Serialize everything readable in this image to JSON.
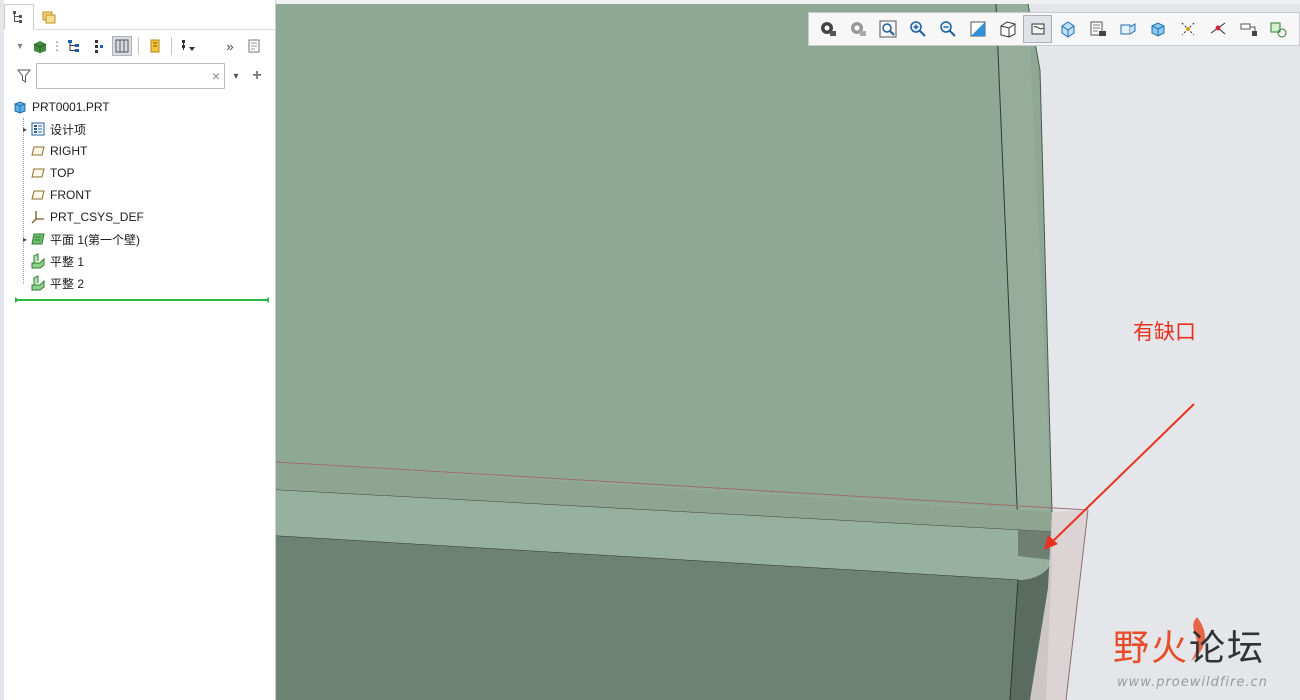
{
  "tree_panel": {
    "filter_placeholder": "",
    "clear_symbol": "×",
    "dropdown_symbol": "▾",
    "add_symbol": "+",
    "more_symbol": "»",
    "root": "PRT0001.PRT",
    "items": [
      {
        "label": "设计项",
        "icon": "design-items-icon",
        "expandable": true
      },
      {
        "label": "RIGHT",
        "icon": "datum-plane-icon",
        "expandable": false
      },
      {
        "label": "TOP",
        "icon": "datum-plane-icon",
        "expandable": false
      },
      {
        "label": "FRONT",
        "icon": "datum-plane-icon",
        "expandable": false
      },
      {
        "label": "PRT_CSYS_DEF",
        "icon": "csys-icon",
        "expandable": false
      },
      {
        "label": "平面 1(第一个壁)",
        "icon": "sheetmetal-wall-icon",
        "expandable": true
      },
      {
        "label": "平整 1",
        "icon": "flat-wall-icon",
        "expandable": false
      },
      {
        "label": "平整 2",
        "icon": "flat-wall-icon",
        "expandable": false
      }
    ]
  },
  "viewport": {
    "annotation_text": "有缺口",
    "watermark_part1": "野火",
    "watermark_part2": "论坛",
    "watermark_url": "www.proewildfire.cn"
  },
  "colors": {
    "model_face": "#8fa895",
    "model_side": "#6c8273",
    "flange_top": "#97b09f",
    "annotation": "#e8321f",
    "insert_line": "#2db84a"
  }
}
